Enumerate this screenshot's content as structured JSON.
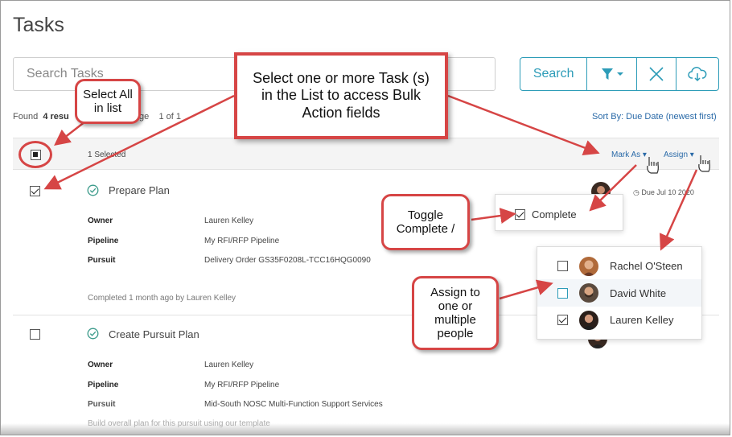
{
  "page": {
    "title": "Tasks"
  },
  "search": {
    "placeholder": "Search Tasks",
    "button_label": "Search"
  },
  "results": {
    "found_label": "Found",
    "count": "4 resu",
    "page_label": "ge",
    "page_of": "1 of 1"
  },
  "sort": {
    "label": "Sort By: Due Date (newest first)"
  },
  "bulk_bar": {
    "selected_label": "1 Selected",
    "mark_as_label": "Mark As",
    "assign_label": "Assign"
  },
  "tasks": [
    {
      "title": "Prepare Plan",
      "due": "Due Jul 10 2020",
      "owner_label": "Owner",
      "owner": "Lauren Kelley",
      "pipeline_label": "Pipeline",
      "pipeline": "My RFI/RFP Pipeline",
      "pursuit_label": "Pursuit",
      "pursuit": "Delivery Order GS35F0208L-TCC16HQG0090",
      "footer": "Completed 1 month ago by Lauren Kelley"
    },
    {
      "title": "Create Pursuit Plan",
      "owner_label": "Owner",
      "owner": "Lauren Kelley",
      "pipeline_label": "Pipeline",
      "pipeline": "My RFI/RFP Pipeline",
      "pursuit_label": "Pursuit",
      "pursuit": "Mid-South NOSC Multi-Function Support Services",
      "footer": "Build overall plan for this pursuit using our template"
    }
  ],
  "mark_as_menu": {
    "complete_label": "Complete"
  },
  "assign_menu": {
    "people": [
      {
        "name": "Rachel O'Steen",
        "checked": false
      },
      {
        "name": "David White",
        "checked": false
      },
      {
        "name": "Lauren Kelley",
        "checked": true
      }
    ]
  },
  "callouts": {
    "select_all": "Select All in list",
    "main": "Select one or more Task (s) in the List to access Bulk Action fields",
    "toggle": "Toggle Complete /",
    "assign": "Assign to one or multiple people"
  },
  "colors": {
    "accent": "#2d9cb8",
    "link": "#2a6aa8",
    "callout_border": "#d64545"
  }
}
